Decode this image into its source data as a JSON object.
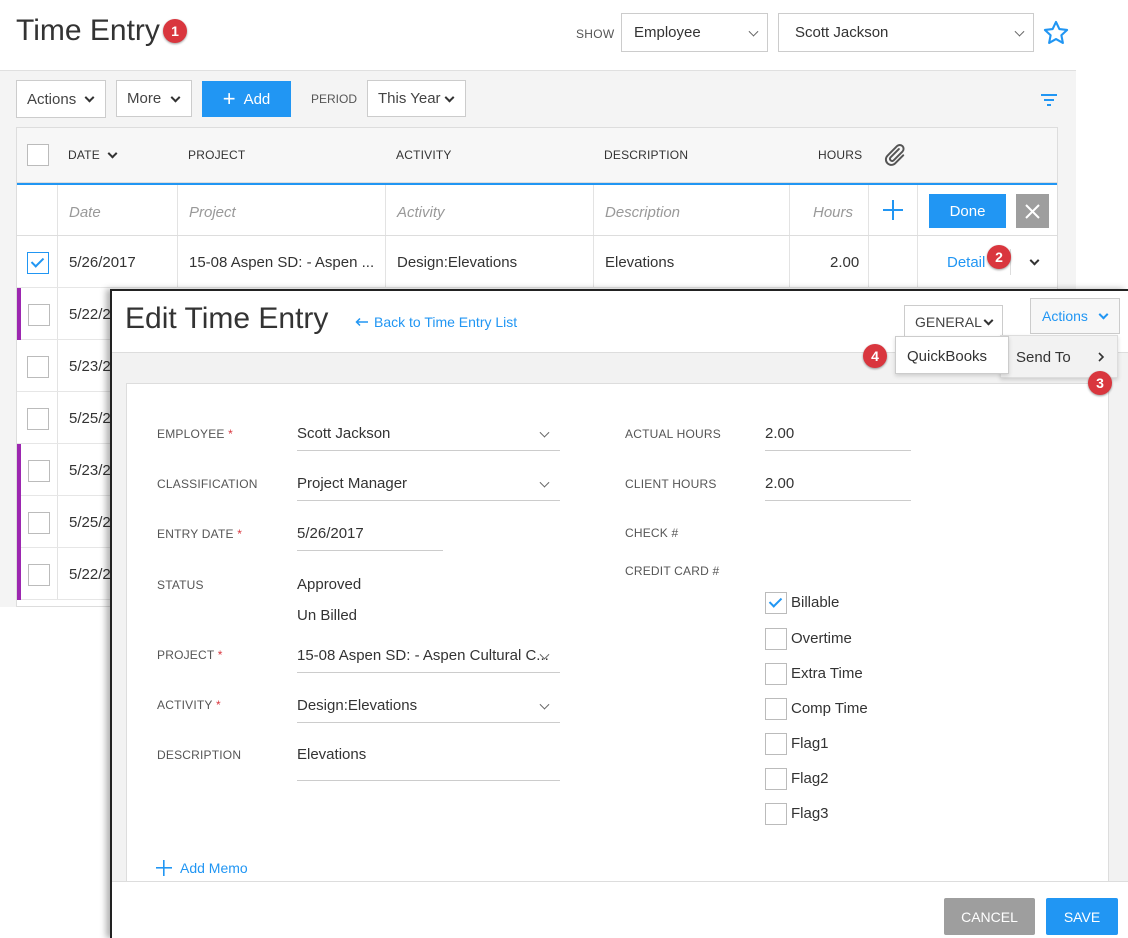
{
  "header": {
    "title": "Time Entry",
    "show_label": "SHOW",
    "show_select": "Employee",
    "employee_select": "Scott Jackson"
  },
  "toolbar": {
    "actions": "Actions",
    "more": "More",
    "add": "Add",
    "period_label": "PERIOD",
    "period_value": "This Year"
  },
  "grid": {
    "columns": [
      "DATE",
      "PROJECT",
      "ACTIVITY",
      "DESCRIPTION",
      "HOURS"
    ],
    "placeholders": {
      "date": "Date",
      "project": "Project",
      "activity": "Activity",
      "description": "Description",
      "hours": "Hours"
    },
    "done": "Done",
    "selected_row": {
      "date": "5/26/2017",
      "project": "15-08 Aspen SD: - Aspen ...",
      "activity": "Design:Elevations",
      "description": "Elevations",
      "hours": "2.00",
      "detail": "Detail"
    },
    "rows": [
      "5/22/2",
      "5/23/2",
      "5/25/2",
      "5/23/2",
      "5/25/2",
      "5/22/2"
    ]
  },
  "badges": [
    "1",
    "2",
    "3",
    "4"
  ],
  "panel": {
    "title": "Edit Time Entry",
    "back_link": "Back to Time Entry List",
    "general": "GENERAL",
    "actions": "Actions",
    "send_to": "Send To",
    "quickbooks": "QuickBooks",
    "labels": {
      "employee": "EMPLOYEE",
      "classification": "CLASSIFICATION",
      "entry_date": "ENTRY DATE",
      "status": "STATUS",
      "project": "PROJECT",
      "activity": "ACTIVITY",
      "description": "DESCRIPTION",
      "actual_hours": "ACTUAL HOURS",
      "client_hours": "CLIENT HOURS",
      "check": "CHECK #",
      "credit_card": "CREDIT CARD #"
    },
    "values": {
      "employee": "Scott Jackson",
      "classification": "Project Manager",
      "entry_date": "5/26/2017",
      "status_approved": "Approved",
      "status_billing": "Un Billed",
      "project": "15-08 Aspen SD: - Aspen Cultural C...",
      "activity": "Design:Elevations",
      "description": "Elevations",
      "actual_hours": "2.00",
      "client_hours": "2.00"
    },
    "checkboxes": [
      {
        "label": "Billable",
        "checked": true
      },
      {
        "label": "Overtime",
        "checked": false
      },
      {
        "label": "Extra Time",
        "checked": false
      },
      {
        "label": "Comp Time",
        "checked": false
      },
      {
        "label": "Flag1",
        "checked": false
      },
      {
        "label": "Flag2",
        "checked": false
      },
      {
        "label": "Flag3",
        "checked": false
      }
    ],
    "add_memo": "Add Memo",
    "cancel": "CANCEL",
    "save": "SAVE"
  },
  "colors": {
    "accent": "#2196f3",
    "badge": "#d9363e",
    "stripe": "#9c27b0",
    "cancel": "#9e9e9e"
  }
}
